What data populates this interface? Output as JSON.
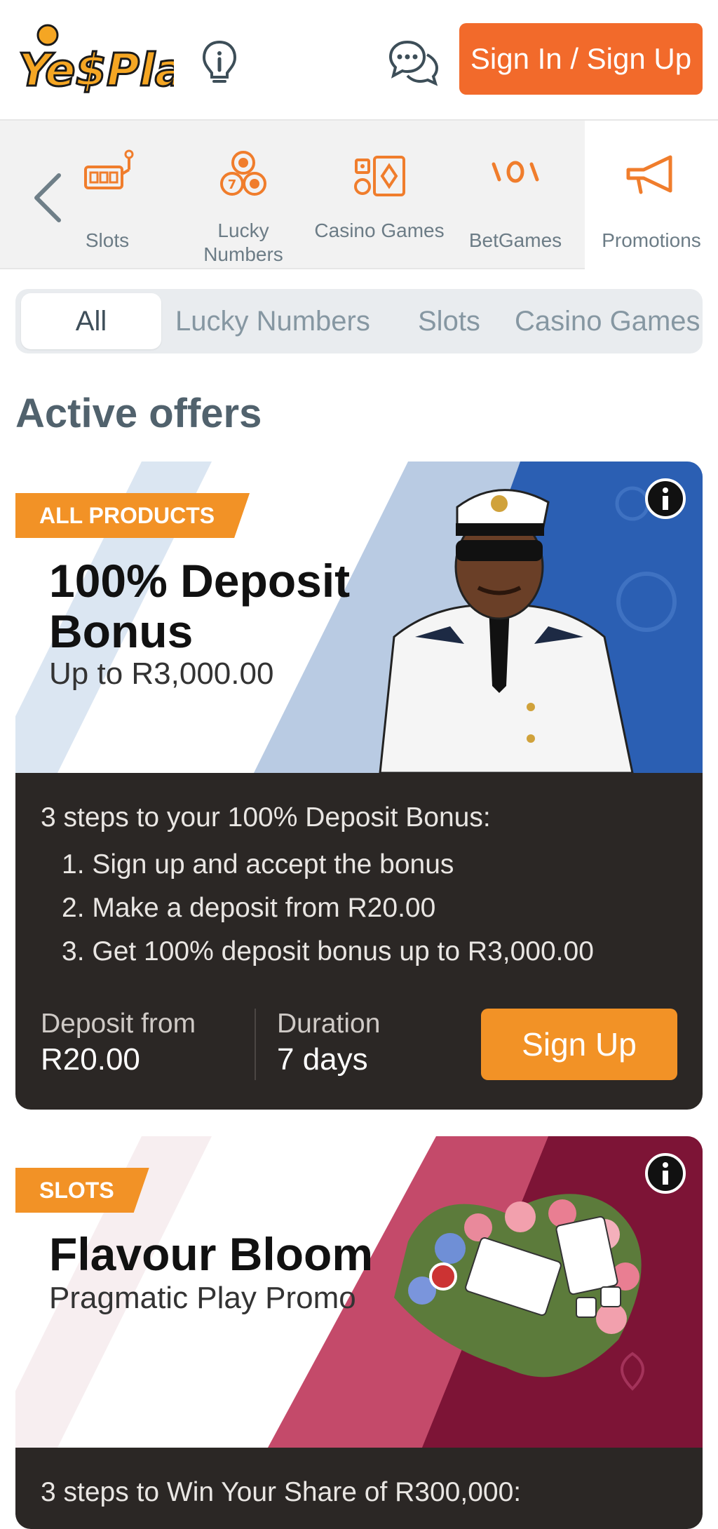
{
  "header": {
    "logo_text": "Ye$Play",
    "signin_label": "Sign In / Sign Up"
  },
  "categories": [
    {
      "label": "Slots",
      "icon": "slot-machine-icon"
    },
    {
      "label": "Lucky Numbers",
      "icon": "lottery-balls-icon"
    },
    {
      "label": "Casino Games",
      "icon": "casino-chips-icon"
    },
    {
      "label": "BetGames",
      "icon": "betgames-icon"
    },
    {
      "label": "Promotions",
      "icon": "megaphone-icon",
      "active": true
    }
  ],
  "filters": [
    "All",
    "Lucky Numbers",
    "Slots",
    "Casino Games"
  ],
  "section_title": "Active offers",
  "offers": [
    {
      "tag": "ALL PRODUCTS",
      "title": "100% Deposit Bonus",
      "subtitle": "Up to R3,000.00",
      "steps_intro": "3 steps to your 100% Deposit Bonus:",
      "steps": [
        "1. Sign up and accept the bonus",
        "2. Make a deposit from R20.00",
        "3. Get 100% deposit bonus up to R3,000.00"
      ],
      "deposit_label": "Deposit from",
      "deposit_value": "R20.00",
      "duration_label": "Duration",
      "duration_value": "7 days",
      "cta": "Sign Up"
    },
    {
      "tag": "SLOTS",
      "title": "Flavour Bloom",
      "subtitle": "Pragmatic Play Promo",
      "steps_intro": "3 steps to Win Your Share of R300,000:"
    }
  ],
  "colors": {
    "brand_orange": "#f26a2b",
    "accent_orange": "#f29226",
    "dark_card": "#2b2725",
    "slate": "#51626d"
  }
}
